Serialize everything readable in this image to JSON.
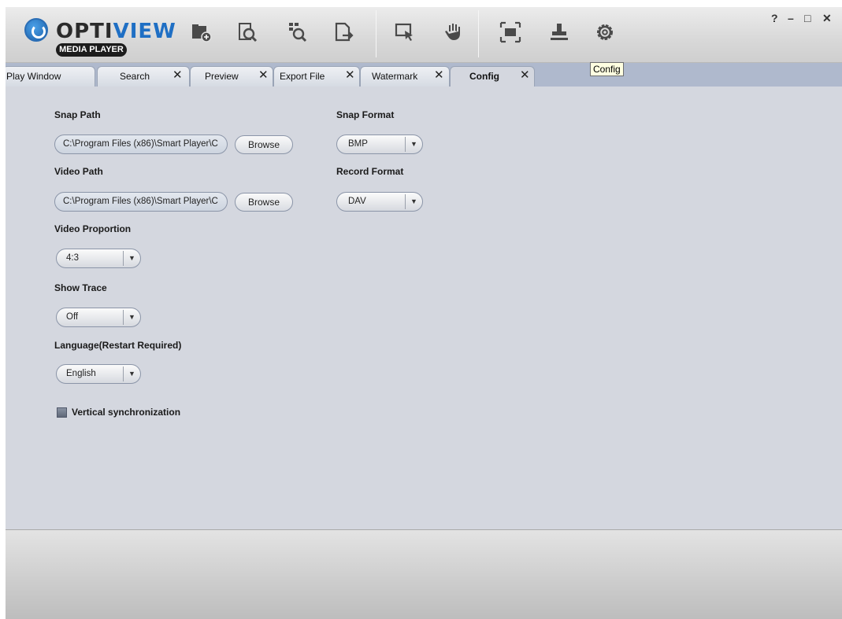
{
  "app": {
    "logo_main_left": "OPTI",
    "logo_main_right": "VIEW",
    "logo_sub": "MEDIA PLAYER"
  },
  "window_controls": {
    "help": "?",
    "minimize": "–",
    "maximize": "□",
    "close": "✕"
  },
  "toolbar": {
    "tools": [
      {
        "icon": "open-folder-icon"
      },
      {
        "icon": "search-file-icon"
      },
      {
        "icon": "preview-search-icon"
      },
      {
        "icon": "export-file-icon"
      },
      {
        "icon": "select-cursor-icon"
      },
      {
        "icon": "hand-pan-icon"
      },
      {
        "icon": "fullscreen-icon"
      },
      {
        "icon": "stamp-watermark-icon"
      },
      {
        "icon": "gear-icon"
      }
    ],
    "tooltip": "Config"
  },
  "tabs": [
    {
      "label": "Play Window",
      "closable": false
    },
    {
      "label": "Search",
      "closable": true
    },
    {
      "label": "Preview",
      "closable": true
    },
    {
      "label": "Export File",
      "closable": true
    },
    {
      "label": "Watermark",
      "closable": true
    },
    {
      "label": "Config",
      "closable": true,
      "active": true
    }
  ],
  "tab_close_glyph": "✕",
  "config": {
    "snap_path_label": "Snap Path",
    "snap_path_value": "C:\\Program Files (x86)\\Smart Player\\C",
    "video_path_label": "Video Path",
    "video_path_value": "C:\\Program Files (x86)\\Smart Player\\C",
    "browse_label": "Browse",
    "snap_format_label": "Snap Format",
    "snap_format_value": "BMP",
    "record_format_label": "Record Format",
    "record_format_value": "DAV",
    "video_proportion_label": "Video Proportion",
    "video_proportion_value": "4:3",
    "show_trace_label": "Show Trace",
    "show_trace_value": "Off",
    "language_label": "Language(Restart Required)",
    "language_value": "English",
    "vsync_label": "Vertical synchronization",
    "dropdown_arrow": "▼"
  },
  "colors": {
    "accent_blue": "#1f6fc4",
    "panel_bg": "#d4d7df",
    "tabstrip_bg": "#afb9cd"
  }
}
